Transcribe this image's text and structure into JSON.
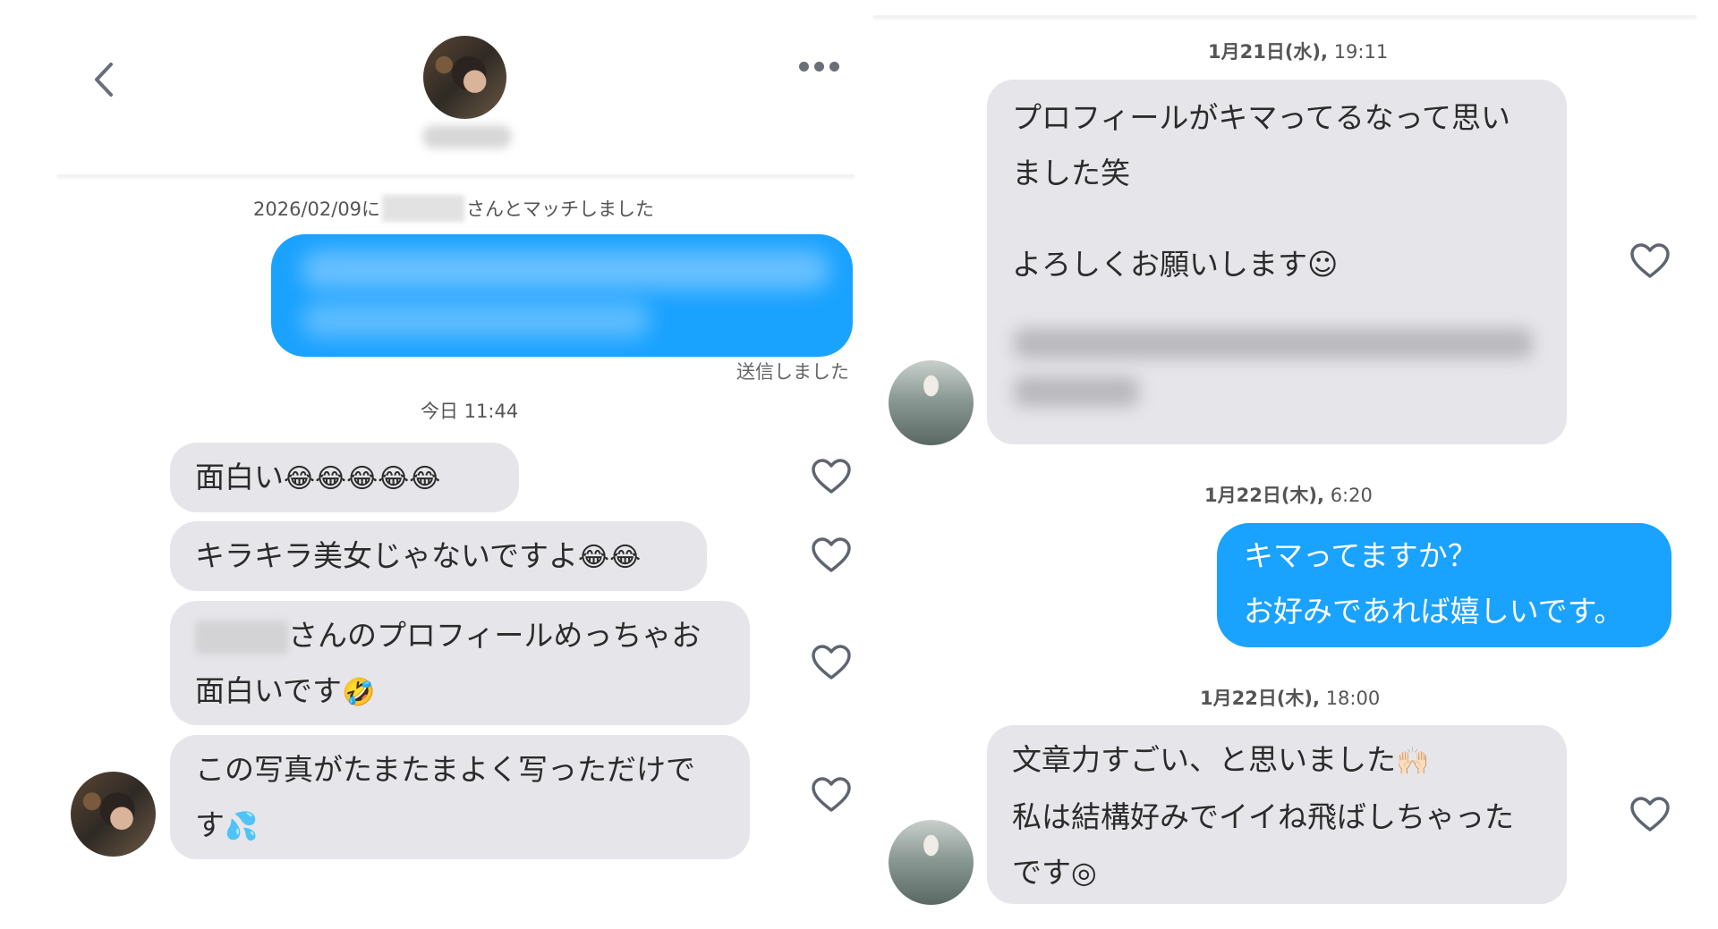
{
  "left_chat": {
    "header": {
      "back_icon": "chevron-left-icon",
      "more_icon": "more-horizontal-icon"
    },
    "match_info": {
      "prefix": "2026/02/09に",
      "suffix": "さんとマッチしました"
    },
    "sent_status": "送信しました",
    "date": "今日 11:44",
    "messages": [
      {
        "text": "面白い",
        "emoji": "😂😂😂😂😂"
      },
      {
        "text": "キラキラ美女じゃないですよ",
        "emoji": "😂😂"
      },
      {
        "line1": "さんのプロフィールめっちゃお",
        "line2": "面白いです",
        "emoji": "🤣"
      },
      {
        "line1": "この写真がたまたまよく写っただけで",
        "line2": "す",
        "emoji": "💦"
      }
    ]
  },
  "right_chat": {
    "date1": {
      "day": "1月21日(水),",
      "time": " 19:11"
    },
    "msg1": {
      "line1": "プロフィールがキマってるなって思い",
      "line2": "ました笑",
      "line3": "よろしくお願いします☺"
    },
    "date2": {
      "day": "1月22日(木),",
      "time": " 6:20"
    },
    "sent": {
      "line1": "キマってますか？",
      "line2": "お好みであれば嬉しいです。"
    },
    "date3": {
      "day": "1月22日(木),",
      "time": " 18:00"
    },
    "msg2": {
      "line1": "文章力すごい、と思いました",
      "emoji": "🙌🏻",
      "line2": "私は結構好みでイイね飛ばしちゃった",
      "line3": "です◎"
    }
  },
  "colors": {
    "sent_bubble": "#1aa2ff",
    "received_bubble": "#e6e6ea",
    "heart_outline": "#5f6471"
  }
}
